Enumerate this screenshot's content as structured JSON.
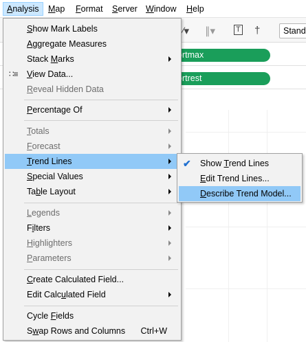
{
  "menubar": {
    "items": [
      {
        "pre": "",
        "u": "A",
        "post": "nalysis",
        "active": true
      },
      {
        "pre": "",
        "u": "M",
        "post": "ap",
        "active": false
      },
      {
        "pre": "",
        "u": "F",
        "post": "ormat",
        "active": false
      },
      {
        "pre": "",
        "u": "S",
        "post": "erver",
        "active": false
      },
      {
        "pre": "",
        "u": "W",
        "post": "indow",
        "active": false
      },
      {
        "pre": "",
        "u": "H",
        "post": "elp",
        "active": false
      }
    ]
  },
  "toolbar": {
    "show_me_value": "Stand"
  },
  "shelves": {
    "pill_1": "ortmax",
    "pill_2": "ortrest"
  },
  "analysis_menu": {
    "items": [
      {
        "pre": "",
        "u": "S",
        "post": "how Mark Labels",
        "disabled": false,
        "submenu": false
      },
      {
        "pre": "",
        "u": "A",
        "post": "ggregate Measures",
        "disabled": false,
        "submenu": false
      },
      {
        "pre": "Stack ",
        "u": "M",
        "post": "arks",
        "disabled": false,
        "submenu": true
      },
      {
        "pre": "",
        "u": "V",
        "post": "iew Data...",
        "disabled": false,
        "submenu": false,
        "icon": "view-data-icon"
      },
      {
        "pre": "",
        "u": "R",
        "post": "eveal Hidden Data",
        "disabled": true,
        "submenu": false
      },
      {
        "pre": "",
        "u": "P",
        "post": "ercentage Of",
        "disabled": false,
        "submenu": true
      },
      {
        "pre": "",
        "u": "T",
        "post": "otals",
        "disabled": true,
        "submenu": true
      },
      {
        "pre": "",
        "u": "F",
        "post": "orecast",
        "disabled": true,
        "submenu": true
      },
      {
        "pre": "",
        "u": "T",
        "post": "rend Lines",
        "disabled": false,
        "submenu": true,
        "hover": true
      },
      {
        "pre": "",
        "u": "S",
        "post": "pecial Values",
        "disabled": false,
        "submenu": true
      },
      {
        "pre": "Ta",
        "u": "b",
        "post": "le Layout",
        "disabled": false,
        "submenu": true
      },
      {
        "pre": "",
        "u": "L",
        "post": "egends",
        "disabled": true,
        "submenu": true
      },
      {
        "pre": "F",
        "u": "i",
        "post": "lters",
        "disabled": false,
        "submenu": true
      },
      {
        "pre": "",
        "u": "H",
        "post": "ighlighters",
        "disabled": true,
        "submenu": true
      },
      {
        "pre": "",
        "u": "P",
        "post": "arameters",
        "disabled": true,
        "submenu": true
      },
      {
        "pre": "",
        "u": "C",
        "post": "reate Calculated Field...",
        "disabled": false,
        "submenu": false
      },
      {
        "pre": "Edit Calc",
        "u": "u",
        "post": "lated Field",
        "disabled": false,
        "submenu": true
      },
      {
        "pre": "Cycle ",
        "u": "F",
        "post": "ields",
        "disabled": false,
        "submenu": false
      },
      {
        "pre": "S",
        "u": "w",
        "post": "ap Rows and Columns",
        "disabled": false,
        "submenu": false,
        "shortcut": "Ctrl+W"
      }
    ]
  },
  "trend_submenu": {
    "items": [
      {
        "pre": "Show ",
        "u": "T",
        "post": "rend Lines",
        "checked": true
      },
      {
        "pre": "",
        "u": "E",
        "post": "dit Trend Lines...",
        "checked": false
      },
      {
        "pre": "",
        "u": "D",
        "post": "escribe Trend Model...",
        "checked": false,
        "hover": true
      }
    ]
  }
}
